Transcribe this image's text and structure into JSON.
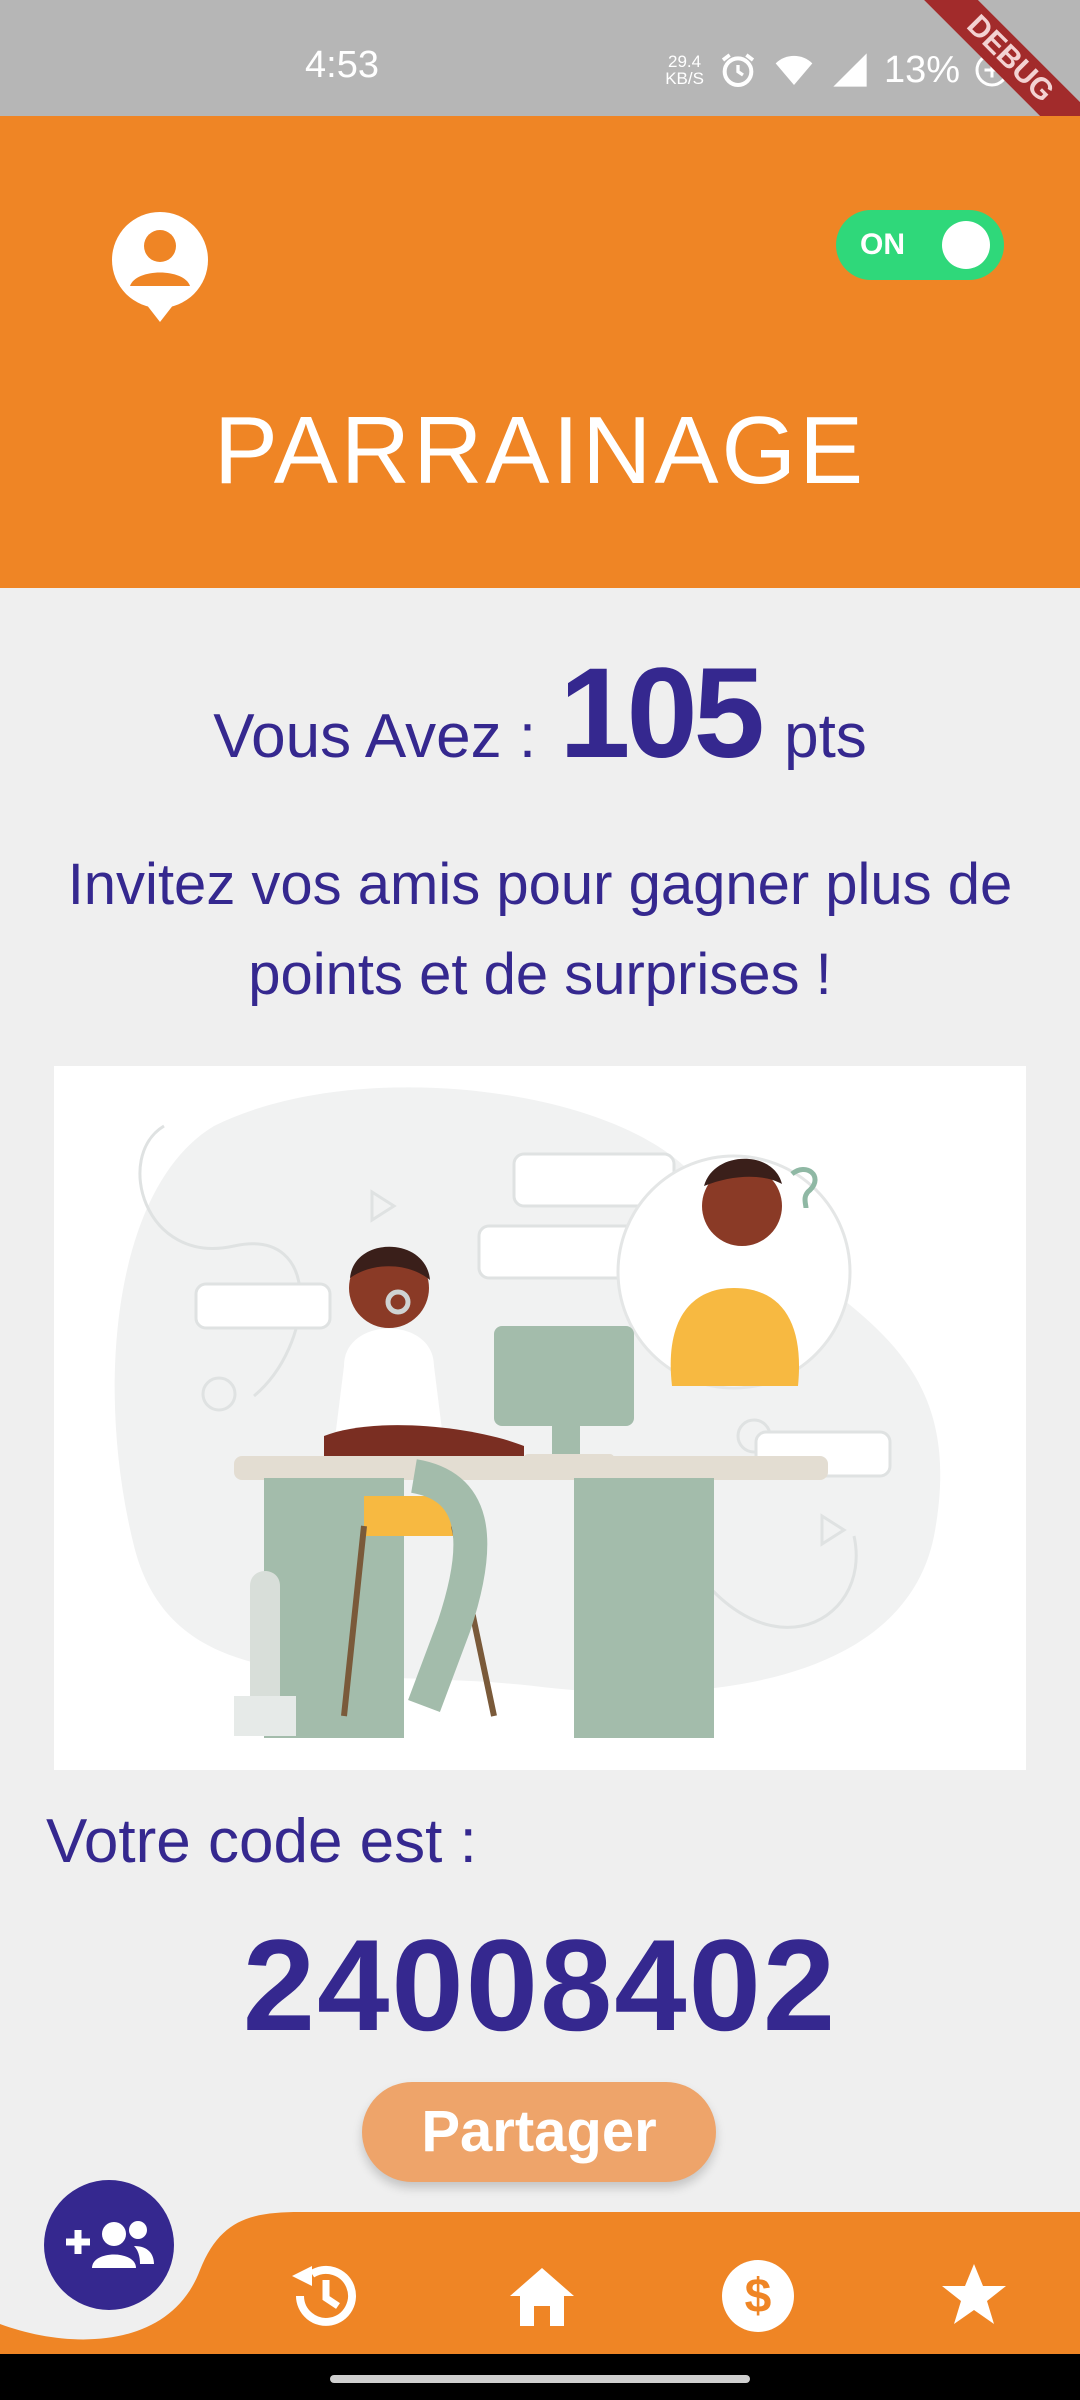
{
  "status_bar": {
    "time": "4:53",
    "net_speed_value": "29.4",
    "net_speed_unit": "KB/S",
    "battery": "13%",
    "debug_banner": "DEBUG"
  },
  "header": {
    "title": "PARRAINAGE",
    "toggle_label": "ON",
    "toggle_on": true,
    "color": "#ef8525"
  },
  "points": {
    "prefix": "Vous Avez :",
    "value": "105",
    "suffix": "pts"
  },
  "invite_text": "Invitez vos amis pour gagner plus de points et de surprises !",
  "code": {
    "label": "Votre code est :",
    "value": "24008402"
  },
  "share_button": "Partager",
  "bottom_nav": {
    "items": [
      {
        "icon": "add-group-icon",
        "active": true
      },
      {
        "icon": "history-icon"
      },
      {
        "icon": "home-icon"
      },
      {
        "icon": "dollar-icon"
      },
      {
        "icon": "star-icon"
      }
    ]
  },
  "colors": {
    "primary_purple": "#35288f",
    "accent_orange": "#ef8525",
    "toggle_green": "#2fd87a",
    "share_button": "#eea46a"
  }
}
